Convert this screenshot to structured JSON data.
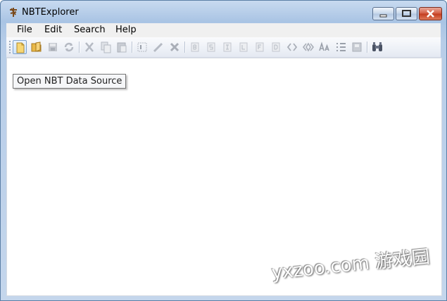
{
  "window": {
    "title": "NBTExplorer"
  },
  "menu": [
    "File",
    "Edit",
    "Search",
    "Help"
  ],
  "toolbar": {
    "buttons": [
      {
        "icon": "open-file-icon",
        "state": "hover"
      },
      {
        "icon": "open-folder-icon",
        "state": "enabled"
      },
      {
        "icon": "save-icon",
        "state": "disabled"
      },
      {
        "icon": "refresh-icon",
        "state": "disabled"
      },
      {
        "icon": "cut-icon",
        "state": "disabled"
      },
      {
        "icon": "copy-icon",
        "state": "disabled"
      },
      {
        "icon": "paste-icon",
        "state": "disabled"
      },
      {
        "icon": "rename-icon",
        "state": "disabled"
      },
      {
        "icon": "edit-icon",
        "state": "disabled"
      },
      {
        "icon": "delete-icon",
        "state": "disabled"
      },
      {
        "icon": "add-byte-tag-icon",
        "state": "disabled"
      },
      {
        "icon": "add-short-tag-icon",
        "state": "disabled"
      },
      {
        "icon": "add-int-tag-icon",
        "state": "disabled"
      },
      {
        "icon": "add-long-tag-icon",
        "state": "disabled"
      },
      {
        "icon": "add-float-tag-icon",
        "state": "disabled"
      },
      {
        "icon": "add-double-tag-icon",
        "state": "disabled"
      },
      {
        "icon": "add-byte-array-icon",
        "state": "disabled"
      },
      {
        "icon": "add-int-array-icon",
        "state": "disabled"
      },
      {
        "icon": "add-string-tag-icon",
        "state": "disabled"
      },
      {
        "icon": "add-list-tag-icon",
        "state": "disabled"
      },
      {
        "icon": "add-compound-tag-icon",
        "state": "disabled"
      },
      {
        "icon": "find-icon",
        "state": "enabled"
      }
    ]
  },
  "tooltip": {
    "text": "Open NBT Data Source"
  },
  "watermark": {
    "text": "yxzoo.com 游戏园"
  },
  "colors": {
    "title_bar": "#b7cde8",
    "close_button": "#c23b1e",
    "disabled_icon": "#b8bcc4"
  }
}
